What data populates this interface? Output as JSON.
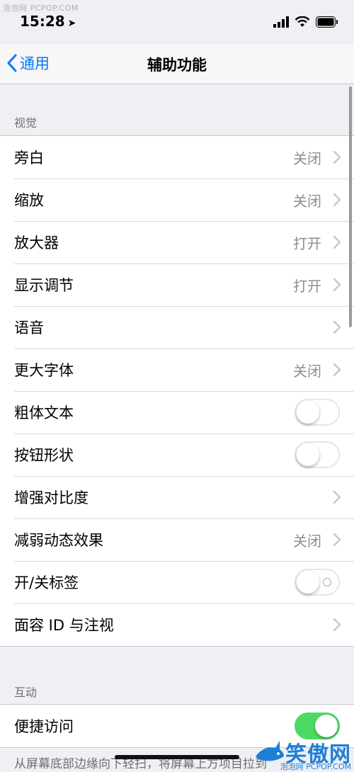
{
  "watermark_top": "泡泡网 PCPOP.COM",
  "status": {
    "time": "15:28",
    "location_arrow": "➤"
  },
  "nav": {
    "back_label": "通用",
    "title": "辅助功能"
  },
  "vision": {
    "header": "视觉",
    "rows": [
      {
        "label": "旁白",
        "value": "关闭"
      },
      {
        "label": "缩放",
        "value": "关闭"
      },
      {
        "label": "放大器",
        "value": "打开"
      },
      {
        "label": "显示调节",
        "value": "打开"
      },
      {
        "label": "语音",
        "value": ""
      },
      {
        "label": "更大字体",
        "value": "关闭"
      },
      {
        "label": "粗体文本",
        "toggle": false
      },
      {
        "label": "按钮形状",
        "toggle": false
      },
      {
        "label": "增强对比度",
        "value": ""
      },
      {
        "label": "减弱动态效果",
        "value": "关闭"
      },
      {
        "label": "开/关标签",
        "toggle": false
      },
      {
        "label": "面容 ID 与注视",
        "value": ""
      }
    ]
  },
  "interaction": {
    "header": "互动",
    "rows": [
      {
        "label": "便捷访问",
        "toggle": true
      }
    ]
  },
  "footer_text": "从屏幕底部边缘向下轻扫，将屏幕上方项目拉到",
  "watermark_br": {
    "chars": "笑傲网",
    "small": "泡泡网 PCPOP.COM"
  },
  "colors": {
    "accent": "#007aff",
    "toggle_on": "#4cd964",
    "background": "#efeff4"
  }
}
